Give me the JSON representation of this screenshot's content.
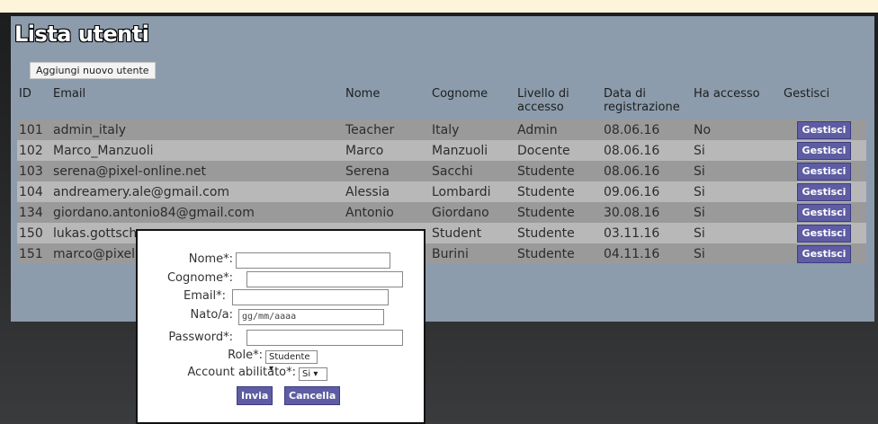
{
  "page": {
    "title": "Lista utenti",
    "add_button": "Aggiungi nuovo utente"
  },
  "table": {
    "headers": [
      "ID",
      "Email",
      "Nome",
      "Cognome",
      "Livello di accesso",
      "Data di registrazione",
      "Ha accesso",
      "Gestisci"
    ],
    "rows": [
      [
        "101",
        "admin_italy",
        "Teacher",
        "Italy",
        "Admin",
        "08.06.16",
        "No",
        "Gestisci"
      ],
      [
        "102",
        "Marco_Manzuoli",
        "Marco",
        "Manzuoli",
        "Docente",
        "08.06.16",
        "Si",
        "Gestisci"
      ],
      [
        "103",
        "serena@pixel-online.net",
        "Serena",
        "Sacchi",
        "Studente",
        "08.06.16",
        "Si",
        "Gestisci"
      ],
      [
        "104",
        "andreamery.ale@gmail.com",
        "Alessia",
        "Lombardi",
        "Studente",
        "09.06.16",
        "Si",
        "Gestisci"
      ],
      [
        "134",
        "giordano.antonio84@gmail.com",
        "Antonio",
        "Giordano",
        "Studente",
        "30.08.16",
        "Si",
        "Gestisci"
      ],
      [
        "150",
        "lukas.gottsch",
        "",
        "Student",
        "Studente",
        "03.11.16",
        "Si",
        "Gestisci"
      ],
      [
        "151",
        "marco@pixel",
        "",
        "Burini",
        "Studente",
        "04.11.16",
        "Si",
        "Gestisci"
      ]
    ]
  },
  "form": {
    "nome_label": "Nome*:",
    "cognome_label": "Cognome*:",
    "email_label": "Email*:",
    "nato_label": "Nato/a:",
    "nato_placeholder": "gg/mm/aaaa",
    "password_label": "Password*:",
    "role_label": "Role*:",
    "role_value": "Studente",
    "account_label": "Account abilitato*:",
    "account_value": "Si",
    "submit": "Invia",
    "cancel": "Cancella"
  },
  "colors": {
    "panel": "#8c9cac",
    "row_odd": "#9a9a9a",
    "row_even": "#b8b8b8",
    "button": "#5e5da3",
    "top_bar": "#fdf5da"
  }
}
